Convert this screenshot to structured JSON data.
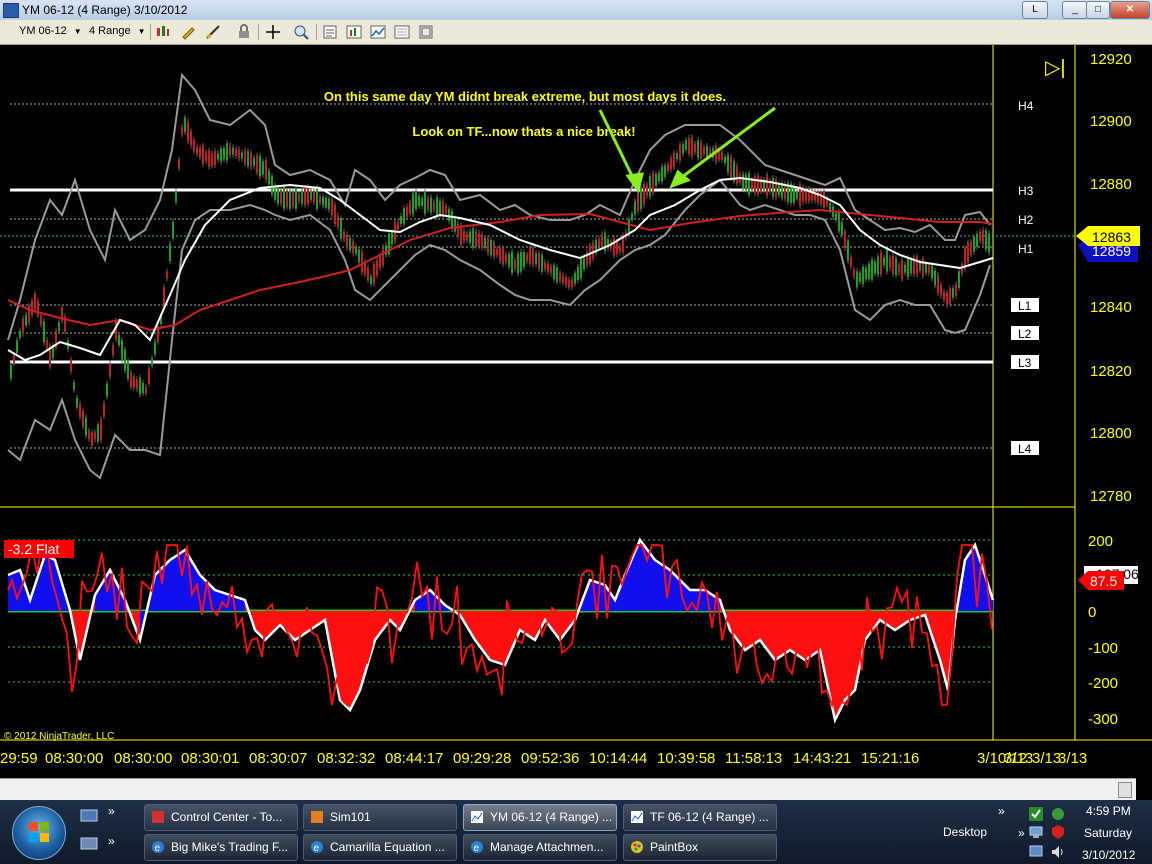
{
  "window": {
    "title": "YM 06-12 (4 Range)  3/10/2012",
    "buttons": {
      "layout": "L",
      "minimize": "_",
      "restore": "□",
      "close": "✕"
    }
  },
  "toolbar": {
    "instrument": "YM 06-12",
    "period": "4 Range",
    "icons": [
      "bar-type-icon",
      "draw-pencil-icon",
      "draw-tool-icon",
      "lock-icon",
      "crosshair-icon",
      "zoom-icon",
      "data-box-icon",
      "indicators-icon",
      "strategies-icon",
      "properties-icon",
      "chart-trader-icon"
    ]
  },
  "chart": {
    "instrument": "YM",
    "price_axis": {
      "ticks": [
        "12920",
        "12900",
        "12880",
        "12860",
        "12840",
        "12820",
        "12800",
        "12780"
      ]
    },
    "level_labels": [
      "H4",
      "H3",
      "H2",
      "H1",
      "L1",
      "L2",
      "L3",
      "L4"
    ],
    "current_price": "12863",
    "last_price_partial": "12859",
    "annotation_line1": "On this same day YM didnt break extreme, but most days it does.",
    "annotation_line2": "Look on TF...now thats a nice break!",
    "play_icon": "▷|",
    "osc_axis": {
      "ticks": [
        "200",
        "100",
        "0",
        "-100",
        "-200",
        "-300"
      ]
    },
    "osc_label": "-3.2 Flat",
    "osc_value": "87.5",
    "osc_value_hidden": "107.06",
    "copyright": "© 2012 NinjaTrader, LLC",
    "time_labels": [
      "29:59",
      "08:30:00",
      "08:30:00",
      "08:30:01",
      "08:30:07",
      "08:32:32",
      "08:44:17",
      "09:29:28",
      "09:52:36",
      "10:14:44",
      "10:39:58",
      "11:58:13",
      "14:43:21",
      "15:21:16",
      "3/10/12",
      "3/13",
      "3/13",
      "3/13"
    ],
    "colors": {
      "accent": "#ffff00",
      "current": "#ffff00",
      "flat_label": "#ff0000",
      "osc_value": "#ff0000"
    }
  },
  "chart_data": {
    "type": "line",
    "title": "",
    "ylim": [
      12775,
      12925
    ],
    "series": [
      {
        "name": "",
        "x": [
          "29:59",
          "08:30:00",
          "08:30:01",
          "08:30:07",
          "08:32:32",
          "08:44:17",
          "09:29:28",
          "09:52:36",
          "10:14:44",
          "10:39:58",
          "11:58:13",
          "14:43:21",
          "15:21:16"
        ],
        "y": [
          12830,
          12805,
          12880,
          12902,
          12866,
          12848,
          12857,
          12855,
          12840,
          12876,
          12895,
          12880,
          12852
        ]
      }
    ],
    "levels": {
      "H4": 12905,
      "H3": 12878,
      "H2": 12869,
      "H1": 12860,
      "L1": 12841,
      "L2": 12832,
      "L3": 12823,
      "L4": 12795
    }
  },
  "scrollbar": {
    "label": ""
  },
  "taskbar": {
    "tasks": [
      {
        "label": "Control Center - To...",
        "icon": "ninja-icon"
      },
      {
        "label": "Sim101",
        "icon": "account-icon"
      },
      {
        "label": "YM 06-12 (4 Range) ...",
        "icon": "chart-icon",
        "active": true
      },
      {
        "label": "TF 06-12 (4 Range) ...",
        "icon": "chart-icon"
      },
      {
        "label": "Big Mike's Trading F...",
        "icon": "ie-icon"
      },
      {
        "label": "Camarilla Equation ...",
        "icon": "ie-icon"
      },
      {
        "label": "Manage Attachmen...",
        "icon": "ie-icon"
      },
      {
        "label": "PaintBox",
        "icon": "paint-icon"
      }
    ],
    "desktop": "Desktop",
    "time": "4:59 PM",
    "day": "Saturday",
    "date": "3/10/2012"
  }
}
